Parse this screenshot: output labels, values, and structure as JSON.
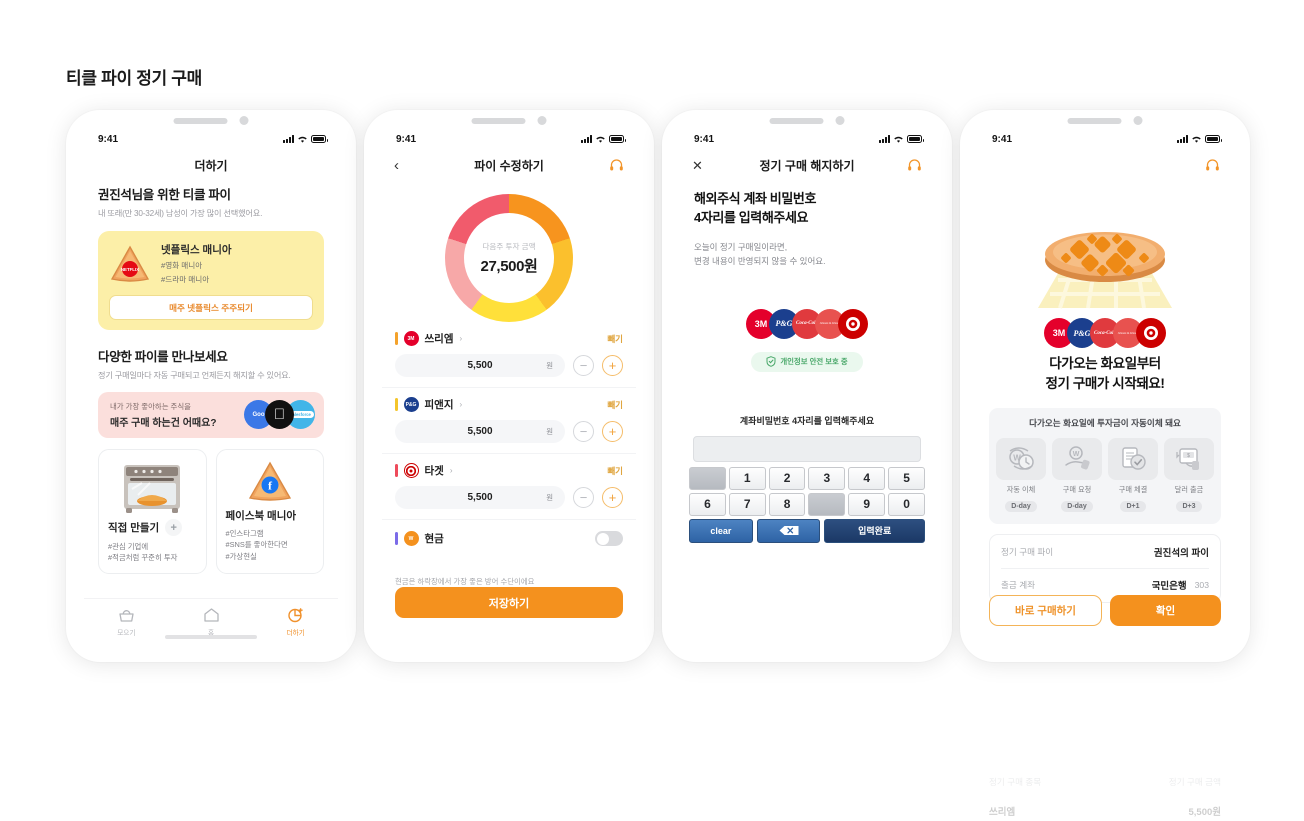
{
  "page": {
    "title": "티클 파이 정기 구매"
  },
  "common": {
    "status_time": "9:41",
    "icons": {
      "signal": "signal-bars-icon",
      "wifi": "wifi-icon",
      "battery": "battery-icon",
      "headset": "headset-support-icon"
    }
  },
  "phone1": {
    "nav_title": "더하기",
    "hero_title": "권진석님을 위한 티클 파이",
    "hero_sub": "내 또래(만 30-32세) 남성이 가장 많이 선택했어요.",
    "featured": {
      "name": "넷플릭스 매니아",
      "tag1": "#영화 매니아",
      "tag2": "#드라마 매니아",
      "cta": "매주 넷플릭스 주주되기",
      "logo_label": "NETFLIX"
    },
    "section2_title": "다양한 파이를 만나보세요",
    "section2_sub": "정기 구매일마다 자동 구매되고 언제든지 해지할 수 있어요.",
    "banner": {
      "small": "내가 가장 좋아하는 주식을",
      "big": "매주 구매 하는건 어때요?",
      "logos": [
        "Goo",
        "",
        "salesforce"
      ]
    },
    "cards": [
      {
        "title": "직접 만들기",
        "has_plus": true,
        "tags": [
          "#관심 기업에",
          "#적금처럼 꾸준히 투자"
        ]
      },
      {
        "title": "페이스북 매니아",
        "has_plus": false,
        "tags": [
          "#인스타그램",
          "#SNS를 좋아한다면",
          "#가상현실"
        ]
      }
    ],
    "tabs": [
      {
        "label": "모으기",
        "icon": "basket-icon",
        "active": false
      },
      {
        "label": "홈",
        "icon": "home-icon",
        "active": false
      },
      {
        "label": "더하기",
        "icon": "pie-plus-icon",
        "active": true
      }
    ]
  },
  "phone2": {
    "nav_title": "파이 수정하기",
    "back_icon": "chevron-left-icon",
    "donut": {
      "center_label": "다음주 투자 금액",
      "center_value": "27,500원"
    },
    "stocks": [
      {
        "name": "쓰리엠",
        "logo": "3M",
        "logo_color": "#E4002B",
        "bar_color": "#F4A22B",
        "amount": "5,500",
        "unit": "원",
        "remove": "빼기"
      },
      {
        "name": "피앤지",
        "logo": "P&G",
        "logo_color": "#1B3F8E",
        "bar_color": "#F4C52B",
        "amount": "5,500",
        "unit": "원",
        "remove": "빼기"
      },
      {
        "name": "타겟",
        "logo": "target",
        "logo_color": "#CC0000",
        "bar_color": "#EE4B5B",
        "amount": "5,500",
        "unit": "원",
        "remove": "빼기"
      }
    ],
    "cash": {
      "name": "현금",
      "logo": "W",
      "bar_color": "#7B6BE8",
      "toggle_on": false
    },
    "cash_note": "현금은 하락장에서 가장 좋은 방어 수단이에요",
    "save_label": "저장하기",
    "minus_icon": "minus-icon",
    "plus_icon": "plus-icon"
  },
  "phone3": {
    "nav_title": "정기 구매 해지하기",
    "close_icon": "close-icon",
    "heading_line1": "해외주식 계좌 비밀번호",
    "heading_line2": "4자리를 입력해주세요",
    "body_line1": "오늘이 정기 구매일이라면,",
    "body_line2": "변경 내용이 반영되지 않을 수 있어요.",
    "brands": [
      {
        "label": "3M",
        "color": "#E4002B"
      },
      {
        "label": "P&G",
        "color": "#1B3F8E"
      },
      {
        "label": "Coca-Cola",
        "color": "#E03A3E"
      },
      {
        "label": "Johnson & Johnson",
        "color": "#E8524F"
      },
      {
        "label": "target",
        "color": "#CC0000"
      }
    ],
    "safe_pill": {
      "text": "개인정보 안전 보호 중",
      "icon": "shield-check-icon"
    },
    "pin_label": "계좌비밀번호 4자리를 입력해주세요",
    "pin_value": "",
    "keypad": {
      "row1": [
        "",
        "1",
        "2",
        "3",
        "4",
        "5"
      ],
      "row2": [
        "6",
        "7",
        "8",
        "",
        "9",
        "0"
      ],
      "clear": "clear",
      "backspace_icon": "backspace-icon",
      "confirm": "입력완료"
    }
  },
  "phone4": {
    "hero_icon": "apple-pie-icon",
    "brands": [
      {
        "label": "3M",
        "color": "#E4002B"
      },
      {
        "label": "P&G",
        "color": "#1B3F8E"
      },
      {
        "label": "Coca-Cola",
        "color": "#E03A3E"
      },
      {
        "label": "Johnson & Johnson",
        "color": "#E8524F"
      },
      {
        "label": "target",
        "color": "#CC0000"
      }
    ],
    "heading_line1": "다가오는 화요일부터",
    "heading_line2": "정기 구매가 시작돼요!",
    "panel_title": "다가오는 화요일에 투자금이 자동이체 돼요",
    "steps": [
      {
        "label": "자동 이체",
        "badge": "D-day",
        "icon": "auto-transfer-icon"
      },
      {
        "label": "구매 요청",
        "badge": "D-day",
        "icon": "purchase-request-icon"
      },
      {
        "label": "구매 체결",
        "badge": "D+1",
        "icon": "purchase-confirm-icon"
      },
      {
        "label": "달러 출금",
        "badge": "D+3",
        "icon": "atm-withdraw-icon"
      }
    ],
    "info": [
      {
        "key": "정기 구매 파이",
        "value": "권진석의 파이"
      },
      {
        "key": "출금 계좌",
        "value": "국민은행",
        "extra": "303"
      }
    ],
    "actions": {
      "secondary": "바로 구매하기",
      "primary": "확인"
    },
    "ghost_rows": {
      "header_left": "정기 구매 종목",
      "header_right": "정기 구매 금액",
      "row_name": "쓰리엠",
      "row_value": "5,500원"
    }
  }
}
